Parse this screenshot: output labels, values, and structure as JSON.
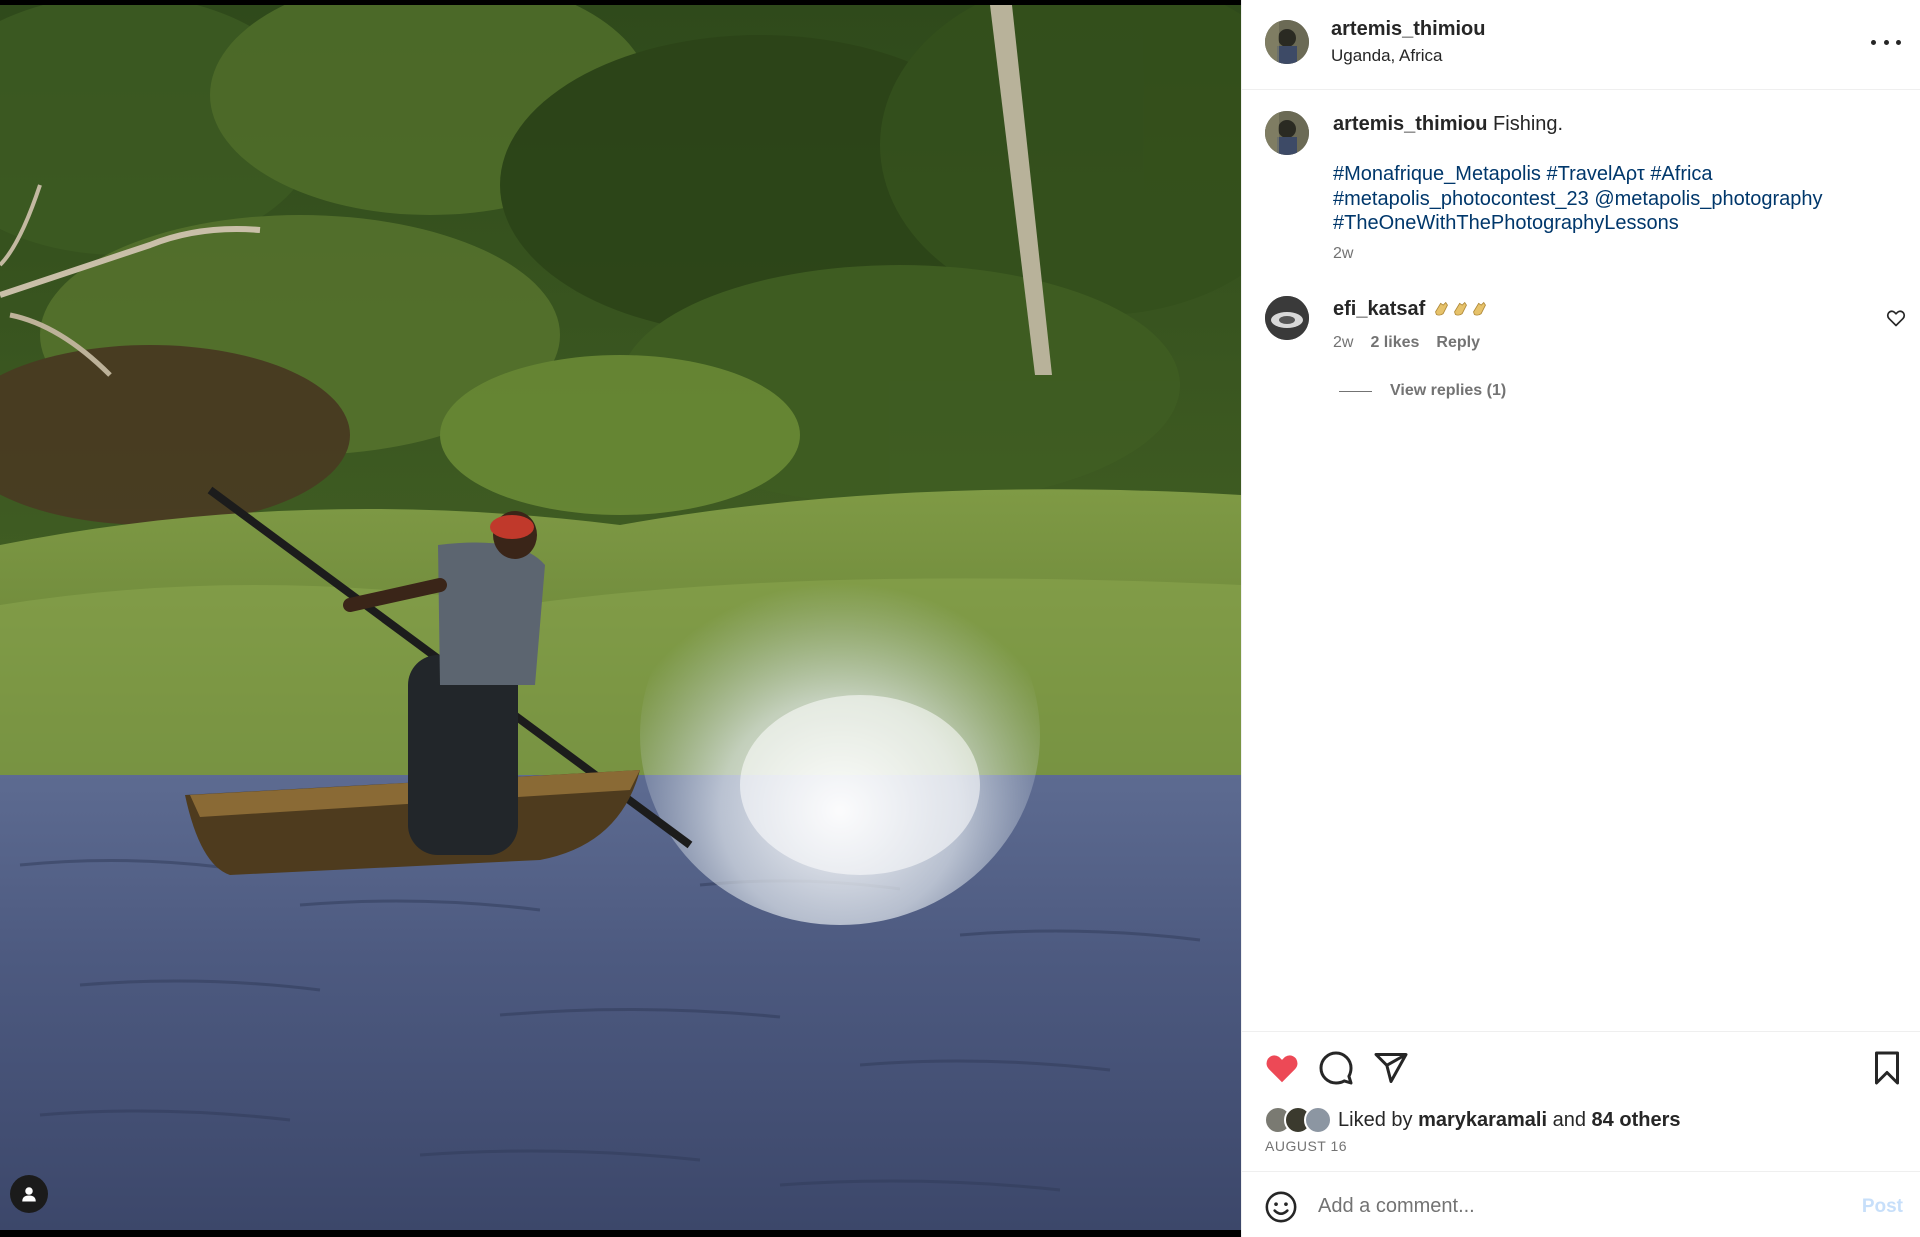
{
  "post": {
    "username": "artemis_thimiou",
    "location": "Uganda, Africa",
    "caption_username": "artemis_thimiou",
    "caption_text": "Fishing.",
    "hashtags": [
      "#Monafrique_Metapolis",
      "#TravelAρτ",
      "#Africa",
      "#metapolis_photocontest_23",
      "@metapolis_photography",
      "#TheOneWithThePhotographyLessons"
    ],
    "time_ago": "2w"
  },
  "comments": [
    {
      "username": "efi_katsaf",
      "text": "👏👏👏",
      "time_ago": "2w",
      "likes": "2 likes",
      "reply_label": "Reply",
      "replies_label": "View replies (1)"
    }
  ],
  "actions": {
    "liked_by_prefix": "Liked by",
    "liked_by_user": "marykaramali",
    "liked_by_and": "and",
    "liked_by_others": "84 others",
    "date": "AUGUST 16",
    "like_color": "#ed4956"
  },
  "comment_box": {
    "placeholder": "Add a comment...",
    "post_label": "Post"
  },
  "icons": [
    "user-tag-icon",
    "more-icon",
    "heart-outline-icon",
    "heart-filled-icon",
    "comment-icon",
    "share-icon",
    "bookmark-icon",
    "emoji-icon",
    "clap-emoji-icon"
  ],
  "colors": {
    "link": "#00376b",
    "secondary_text": "#737373",
    "post_button_disabled": "#c7dffa",
    "like": "#ed4956"
  }
}
